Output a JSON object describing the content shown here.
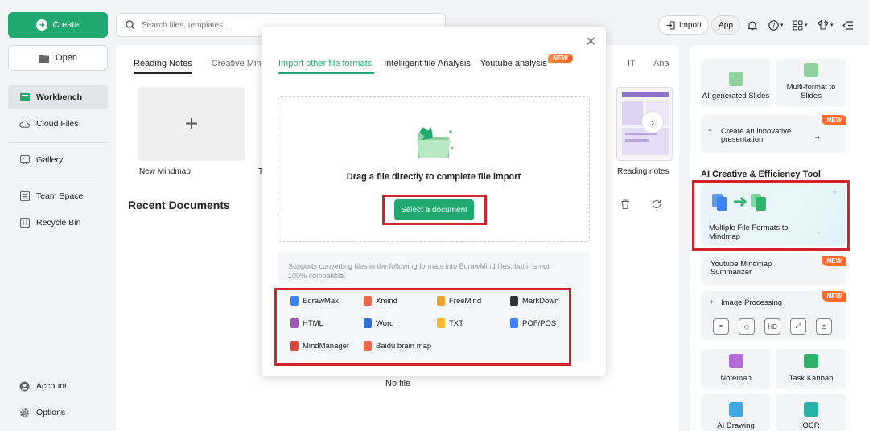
{
  "sidebar": {
    "create_label": "Create",
    "open_label": "Open",
    "items": [
      {
        "label": "Workbench"
      },
      {
        "label": "Cloud Files"
      },
      {
        "label": "Gallery"
      },
      {
        "label": "Team Space"
      },
      {
        "label": "Recycle Bin"
      }
    ],
    "bottom": [
      {
        "label": "Account"
      },
      {
        "label": "Options"
      }
    ]
  },
  "topbar": {
    "search_placeholder": "Search files, templates...",
    "import_label": "Import",
    "app_label": "App"
  },
  "main": {
    "tabs": [
      "Reading Notes",
      "Creative Mind"
    ],
    "tabs_right": [
      "IT",
      "Ana"
    ],
    "new_mindmap_label": "New Mindmap",
    "partial_card_label": "T",
    "reading_notes_label": "Reading notes",
    "recent_title": "Recent Documents",
    "no_file": "No file"
  },
  "dialog": {
    "tabs": [
      "Import other file formats.",
      "Intelligent file Analysis",
      "Youtube analysis"
    ],
    "new_badge": "NEW",
    "drop_text": "Drag a file directly to complete file import",
    "select_label": "Select a document",
    "formats_note": "Supports converting files in the following formats into EdrawMind files, but it is not 100% compatible.",
    "formats": [
      {
        "name": "EdrawMax",
        "color": "#3b82f6"
      },
      {
        "name": "Xmind",
        "color": "#ef6a4a"
      },
      {
        "name": "FreeMind",
        "color": "#f0a030"
      },
      {
        "name": "MarkDown",
        "color": "#333333"
      },
      {
        "name": "HTML",
        "color": "#9b59b6"
      },
      {
        "name": "Word",
        "color": "#2f6fd6"
      },
      {
        "name": "TXT",
        "color": "#f5b82e"
      },
      {
        "name": "POF/POS",
        "color": "#3b82f6"
      },
      {
        "name": "MindManager",
        "color": "#e0453a"
      },
      {
        "name": "Baidu brain map",
        "color": "#ef6a4a"
      }
    ]
  },
  "rpanel": {
    "tiles": [
      {
        "label": "AI-generated Slides",
        "color": "#8fd19e"
      },
      {
        "label": "Multi-format to Slides",
        "color": "#8fd19e"
      }
    ],
    "innovative": "Create an innovative presentation",
    "new_badge": "NEW",
    "section_title": "AI Creative & Efficiency Tool",
    "multi_formats": "Multiple File Formats to Mindmap",
    "youtube": "Youtube Mindmap Summarizer",
    "image_processing": "Image Processing",
    "bottom_tiles": [
      {
        "label": "Notemap",
        "color": "#b36bd6"
      },
      {
        "label": "Task Kanban",
        "color": "#2fb36b"
      },
      {
        "label": "AI Drawing",
        "color": "#3fa8e0"
      },
      {
        "label": "OCR",
        "color": "#2bb0a8"
      }
    ]
  },
  "colors": {
    "accent": "#1fa971",
    "highlight": "#d1232a",
    "new_badge": "#ff6b2c"
  }
}
